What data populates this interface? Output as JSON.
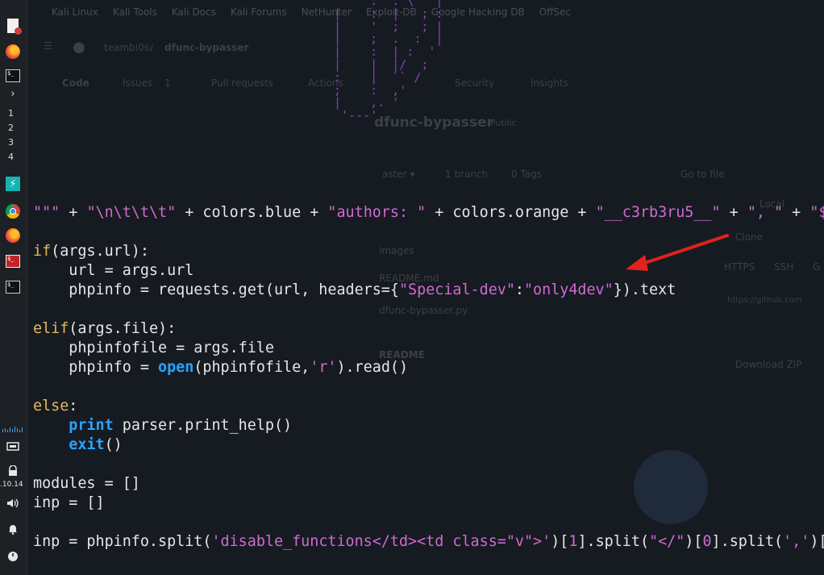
{
  "bookmarks": [
    "Kali Linux",
    "Kali Tools",
    "Kali Docs",
    "Kali Forums",
    "NetHunter",
    "Exploit-DB",
    "Google Hacking DB",
    "OffSec"
  ],
  "github": {
    "owner": "teambi0s",
    "repo": "dfunc-bypasser",
    "tabs": [
      "Code",
      "Issues",
      "Pull requests",
      "Actions",
      "Security",
      "Insights"
    ],
    "issues_count": "1",
    "repo_title": "dfunc-bypasser",
    "visibility": "Public",
    "branch_info": "1 branch",
    "tags_info": "0 Tags",
    "goto_file": "Go to file",
    "files": [
      "images",
      "README.md",
      "dfunc-bypasser.py"
    ],
    "readme": "README",
    "clone": "Clone",
    "clone_tabs": [
      "HTTPS",
      "SSH",
      "G"
    ],
    "clone_url": "https://github.com",
    "download_zip": "Download ZIP",
    "local": "Local"
  },
  "dock": {
    "workspaces": [
      "1",
      "2",
      "3",
      "4"
    ],
    "ip": ".10.14"
  },
  "ascii_art": "'    :  . \\   |\n|    :  |   ; :\n|    '  ;   ; |\n|    ;  .  :  |\n|    :  | :  '\n|    |  |/  ;\n:    |  `` /\n;    :  ,' \n|    ,. '\n '---'",
  "code_lines": {
    "l1": [
      "\"\"\"",
      " + ",
      "\"\\n\\t\\t\\t\"",
      " + colors.blue + ",
      "\"authors: \"",
      " + colors.orange + ",
      "\"__c3rb3ru5__\"",
      " + ",
      "\", \"",
      " + ",
      "\"$_"
    ],
    "if_kw": "if",
    "if_rest": "(args.url):",
    "url_line": "    url = args.url",
    "php_a": "    phpinfo = requests.get(url, headers={",
    "special": "\"Special-dev\"",
    "colon": ":",
    "only4": "\"only4dev\"",
    "php_b": "}).text",
    "elif_kw": "elif",
    "elif_rest": "(args.file):",
    "file_line": "    phpinfofile = args.file",
    "open_a": "    phpinfo = ",
    "open_kw": "open",
    "open_b": "(phpinfofile,",
    "open_r": "'r'",
    "open_c": ").read()",
    "else_kw": "else",
    "else_rest": ":",
    "print_kw": "print",
    "print_rest": " parser.print_help()",
    "exit_kw": "exit",
    "exit_rest": "()",
    "modules": "modules = []",
    "inp": "inp = []",
    "split_a": "inp = phpinfo.split(",
    "split_s1": "'disable_functions</td><td class=\"v\">'",
    "split_b": ")[",
    "split_n1": "1",
    "split_c": "].split(",
    "split_s2": "\"</\"",
    "split_d": ")[",
    "split_n2": "0",
    "split_e": "].split(",
    "split_s3": "','",
    "split_f": ")["
  },
  "colors": {
    "code_text": "#e6e6e6",
    "string": "#d06ad0",
    "keyword_orange": "#e7b85a",
    "builtin_blue": "#29a3ff",
    "ascii_purple": "#8a3fb5",
    "arrow_red": "#e0231c",
    "background": "#161b22"
  }
}
